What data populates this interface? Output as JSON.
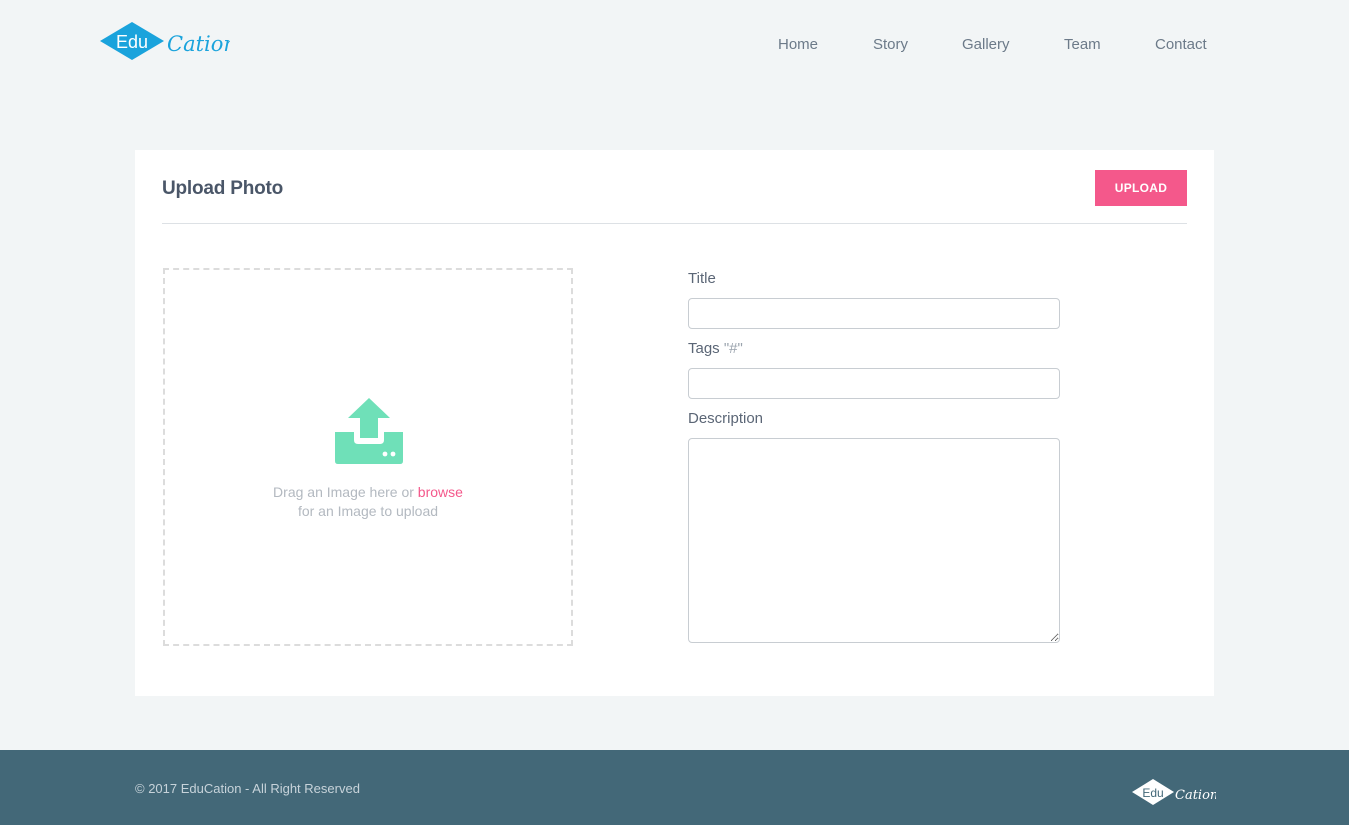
{
  "brand": {
    "name_part1": "Edu",
    "name_part2": "Cation",
    "primary_color": "#1aa3dc",
    "accent_color": "#f4588b",
    "icon_color": "#6fe0b8"
  },
  "nav": {
    "items": [
      {
        "label": "Home"
      },
      {
        "label": "Story"
      },
      {
        "label": "Gallery"
      },
      {
        "label": "Team"
      },
      {
        "label": "Contact"
      }
    ]
  },
  "upload_card": {
    "title": "Upload Photo",
    "upload_button_label": "UPLOAD",
    "dropzone": {
      "icon": "upload-tray-icon",
      "text_before": "Drag an Image here or ",
      "link_text": "browse",
      "text_after": " for an Image to upload"
    },
    "form": {
      "title_label": "Title",
      "title_value": "",
      "tags_label": "Tags ",
      "tags_hint": "\"#\"",
      "tags_value": "",
      "description_label": "Description",
      "description_value": ""
    }
  },
  "footer": {
    "copyright": "© 2017 EduCation - All Right Reserved"
  }
}
